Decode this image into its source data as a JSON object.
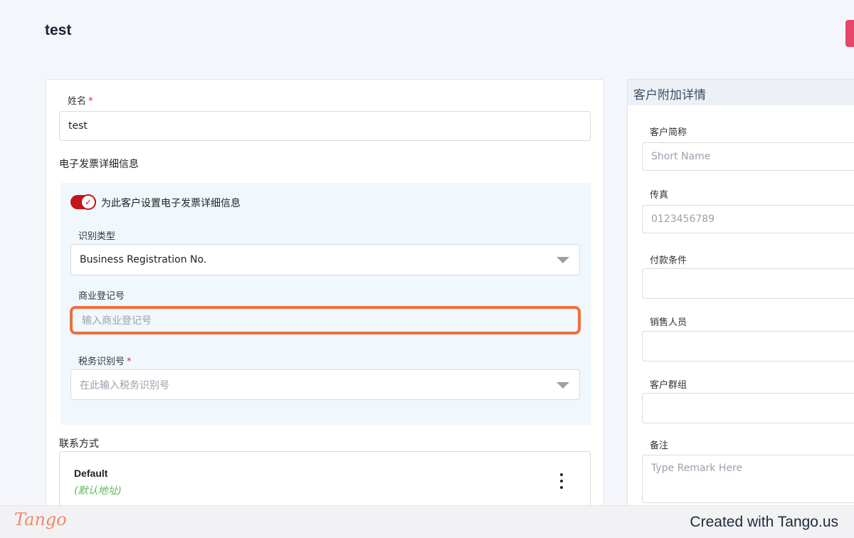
{
  "page": {
    "title": "test"
  },
  "main_form": {
    "name_label": "姓名",
    "name_required": "*",
    "name_value": "test",
    "einvoice_section_title": "电子发票详细信息",
    "einvoice_toggle_label": "为此客户设置电子发票详细信息",
    "einvoice_toggle_on": true,
    "id_type_label": "识别类型",
    "id_type_value": "Business Registration No.",
    "brn_label": "商业登记号",
    "brn_placeholder": "输入商业登记号",
    "tin_label": "税务识别号",
    "tin_required": "*",
    "tin_placeholder": "在此输入税务识别号",
    "contact_section_title": "联系方式",
    "contact_name": "Default",
    "contact_default_tag": "(默认地址)"
  },
  "side_panel": {
    "title": "客户附加详情",
    "short_name_label": "客户简称",
    "short_name_placeholder": "Short Name",
    "fax_label": "传真",
    "fax_placeholder": "0123456789",
    "payment_terms_label": "付款条件",
    "salesperson_label": "销售人员",
    "customer_group_label": "客户群组",
    "remark_label": "备注",
    "remark_placeholder": "Type Remark Here"
  },
  "footer": {
    "logo": "Tango",
    "credit": "Created with Tango.us"
  },
  "colors": {
    "accent_red": "#c4161c",
    "highlight_orange": "#f26d3d",
    "default_tag_green": "#5cb85c",
    "required_red": "#d9224a"
  },
  "icons": [
    "check-icon",
    "chevron-down-icon",
    "kebab-menu-icon"
  ]
}
